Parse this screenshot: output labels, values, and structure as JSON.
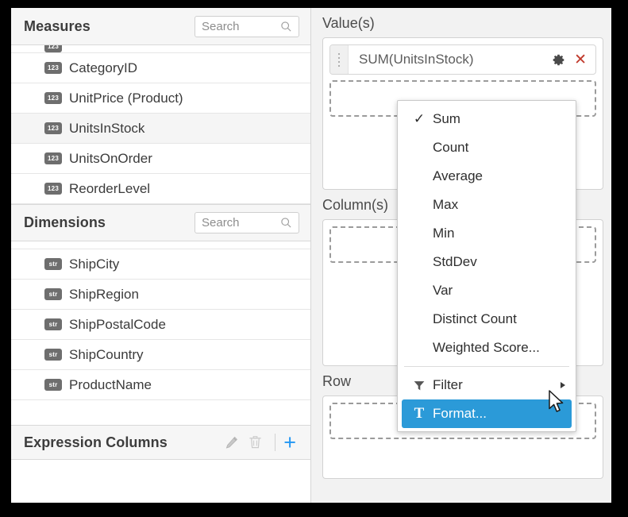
{
  "left_panel": {
    "measures": {
      "title": "Measures",
      "search_placeholder": "Search",
      "search_value": "",
      "items": [
        {
          "type": "123",
          "label": "CategoryID"
        },
        {
          "type": "123",
          "label": "UnitPrice (Product)"
        },
        {
          "type": "123",
          "label": "UnitsInStock",
          "selected": true
        },
        {
          "type": "123",
          "label": "UnitsOnOrder"
        },
        {
          "type": "123",
          "label": "ReorderLevel"
        }
      ]
    },
    "dimensions": {
      "title": "Dimensions",
      "search_placeholder": "Search",
      "search_value": "",
      "items": [
        {
          "type": "str",
          "label": "ShipCity"
        },
        {
          "type": "str",
          "label": "ShipRegion"
        },
        {
          "type": "str",
          "label": "ShipPostalCode"
        },
        {
          "type": "str",
          "label": "ShipCountry"
        },
        {
          "type": "str",
          "label": "ProductName"
        }
      ]
    },
    "expression_columns": {
      "title": "Expression Columns",
      "edit_icon": "pencil-icon",
      "delete_icon": "trash-icon",
      "add_label": "+"
    }
  },
  "right_panel": {
    "value_zone": {
      "label": "Value(s)",
      "pill": {
        "text": "SUM(UnitsInStock)",
        "settings_icon": "gear-icon",
        "remove_label": "✕"
      }
    },
    "column_zone": {
      "label": "Column(s)"
    },
    "row_zone": {
      "label": "Row"
    }
  },
  "aggregation_menu": {
    "highlight_color": "#2b9ad8",
    "items": [
      {
        "label": "Sum",
        "checked": true
      },
      {
        "label": "Count"
      },
      {
        "label": "Average"
      },
      {
        "label": "Max"
      },
      {
        "label": "Min"
      },
      {
        "label": "StdDev"
      },
      {
        "label": "Var"
      },
      {
        "label": "Distinct Count"
      },
      {
        "label": "Weighted Score..."
      },
      {
        "label": "Filter",
        "icon": "filter-icon",
        "submenu": true
      },
      {
        "label": "Format...",
        "icon": "text-format-icon",
        "highlighted": true
      }
    ]
  }
}
